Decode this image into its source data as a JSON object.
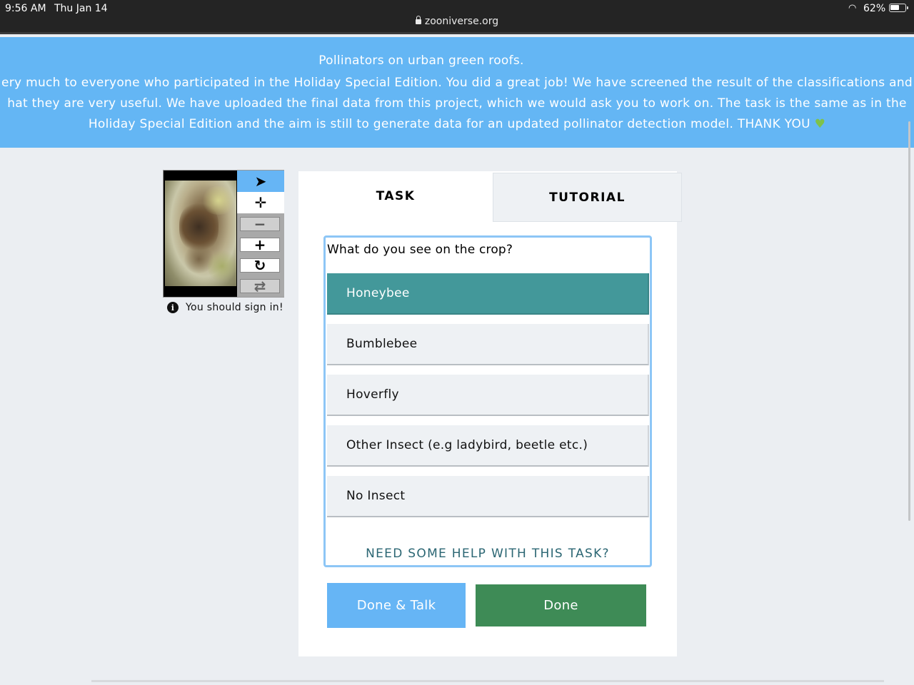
{
  "status_bar": {
    "time": "9:56 AM",
    "date": "Thu Jan 14",
    "url": "zooniverse.org",
    "battery_percent": "62%",
    "battery_level": 0.62
  },
  "banner": {
    "title": "Pollinators on urban green roofs.",
    "message_line1": "ery much to everyone who participated in the Holiday Special Edition. You did a great job! We have screened the result of the classifications and",
    "message_line2": "hat they are very useful. We have uploaded the final data from this project, which we would ask you to work on. The task is the same as in the",
    "message_line3": "Holiday Special Edition and the aim is still to generate data for an updated pollinator detection model. THANK YOU",
    "heart_icon": "green-heart-icon",
    "background_color": "#64b6f4"
  },
  "viewer": {
    "tools": [
      {
        "name": "select-tool",
        "icon": "cursor-arrow-icon",
        "glyph": "➤"
      },
      {
        "name": "move-tool",
        "icon": "move-arrows-icon",
        "glyph": "✛"
      },
      {
        "name": "zoom-out-tool",
        "icon": "minus-icon",
        "glyph": "−"
      },
      {
        "name": "zoom-in-tool",
        "icon": "plus-icon",
        "glyph": "+"
      },
      {
        "name": "rotate-tool",
        "icon": "rotate-icon",
        "glyph": "↻"
      },
      {
        "name": "reset-tool",
        "icon": "refresh-icon",
        "glyph": "⇄"
      }
    ],
    "signin_message": "You should sign in!",
    "info_icon": "i"
  },
  "tabs": {
    "task_label": "TASK",
    "tutorial_label": "TUTORIAL",
    "active": "TASK"
  },
  "task": {
    "question": "What do you see on the crop?",
    "answers": [
      {
        "label": "Honeybee",
        "selected": true
      },
      {
        "label": "Bumblebee",
        "selected": false
      },
      {
        "label": "Hoverfly",
        "selected": false
      },
      {
        "label": "Other Insect (e.g ladybird, beetle etc.)",
        "selected": false
      },
      {
        "label": "No Insect",
        "selected": false
      }
    ],
    "help_label": "NEED SOME HELP WITH THIS TASK?",
    "selected_color": "#43989a"
  },
  "actions": {
    "done_talk_label": "Done & Talk",
    "done_label": "Done",
    "done_talk_color": "#66b5f5",
    "done_color": "#3e8b56"
  }
}
